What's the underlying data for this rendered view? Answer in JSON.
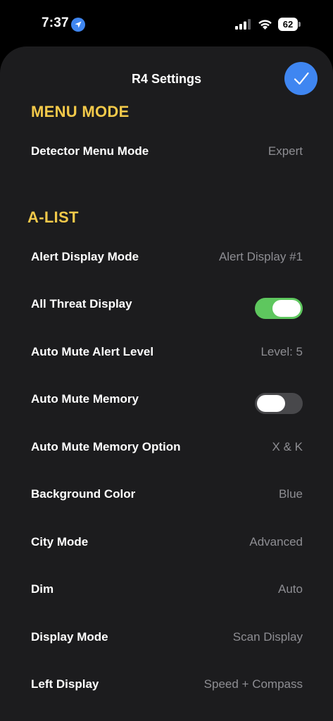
{
  "status_bar": {
    "time": "7:37",
    "battery": "62"
  },
  "sheet": {
    "title": "R4 Settings",
    "done_icon": "checkmark-icon"
  },
  "sections": {
    "menu_mode": {
      "header": "MENU MODE",
      "rows": [
        {
          "label": "Detector Menu Mode",
          "value": "Expert"
        }
      ]
    },
    "a_list": {
      "header": "A-LIST",
      "rows": [
        {
          "label": "Alert Display Mode",
          "value": "Alert Display #1"
        },
        {
          "label": "All Threat Display",
          "toggle": true
        },
        {
          "label": "Auto Mute Alert Level",
          "value": "Level: 5"
        },
        {
          "label": "Auto Mute Memory",
          "toggle": false
        },
        {
          "label": "Auto Mute Memory Option",
          "value": "X & K"
        },
        {
          "label": "Background Color",
          "value": "Blue"
        },
        {
          "label": "City Mode",
          "value": "Advanced"
        },
        {
          "label": "Dim",
          "value": "Auto"
        },
        {
          "label": "Display Mode",
          "value": "Scan Display"
        },
        {
          "label": "Left Display",
          "value": "Speed + Compass"
        }
      ]
    }
  },
  "colors": {
    "sheet_background": "#1c1c1e",
    "section_header": "#f2c94a",
    "accent_blue": "#3f86f1",
    "toggle_on": "#5ec75e",
    "toggle_off": "#48484b",
    "value_gray": "#8e8e93"
  }
}
